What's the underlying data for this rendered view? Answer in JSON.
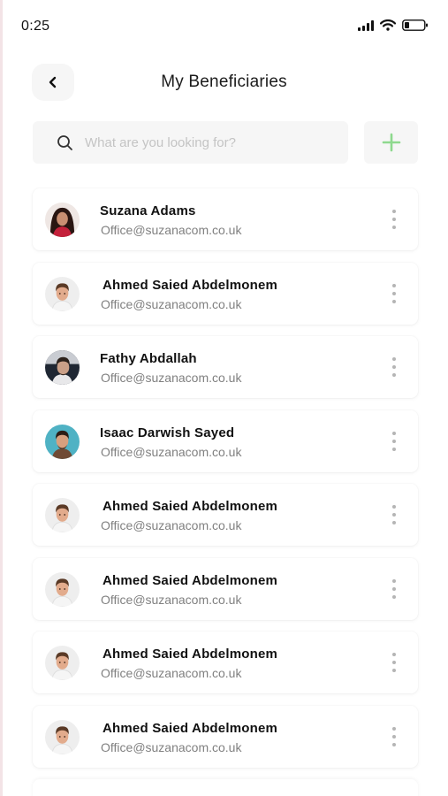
{
  "status_bar": {
    "time": "0:25"
  },
  "header": {
    "title": "My Beneficiaries",
    "back_icon": "chevron-left-icon"
  },
  "search": {
    "placeholder": "What are you looking for?",
    "value": "",
    "icon": "search-icon"
  },
  "add_button": {
    "icon": "plus-icon",
    "color": "#8ed98e"
  },
  "colors": {
    "card_bg": "#ffffff",
    "field_bg": "#f6f6f6",
    "email_text": "#808080",
    "dots": "#b5b5b5"
  },
  "beneficiaries": [
    {
      "name": "Suzana Adams",
      "email": "Office@suzanacom.co.uk",
      "avatar": "woman-avatar"
    },
    {
      "name": "Ahmed Saied Abdelmonem",
      "email": "Office@suzanacom.co.uk",
      "avatar": "man-avatar"
    },
    {
      "name": "Fathy Abdallah",
      "email": "Office@suzanacom.co.uk",
      "avatar": "man-dark-avatar"
    },
    {
      "name": "Isaac Darwish Sayed",
      "email": "Office@suzanacom.co.uk",
      "avatar": "man-teal-avatar"
    },
    {
      "name": "Ahmed Saied Abdelmonem",
      "email": "Office@suzanacom.co.uk",
      "avatar": "man-avatar"
    },
    {
      "name": "Ahmed Saied Abdelmonem",
      "email": "Office@suzanacom.co.uk",
      "avatar": "man-avatar"
    },
    {
      "name": "Ahmed Saied Abdelmonem",
      "email": "Office@suzanacom.co.uk",
      "avatar": "man-avatar"
    },
    {
      "name": "Ahmed Saied Abdelmonem",
      "email": "Office@suzanacom.co.uk",
      "avatar": "man-avatar"
    }
  ]
}
